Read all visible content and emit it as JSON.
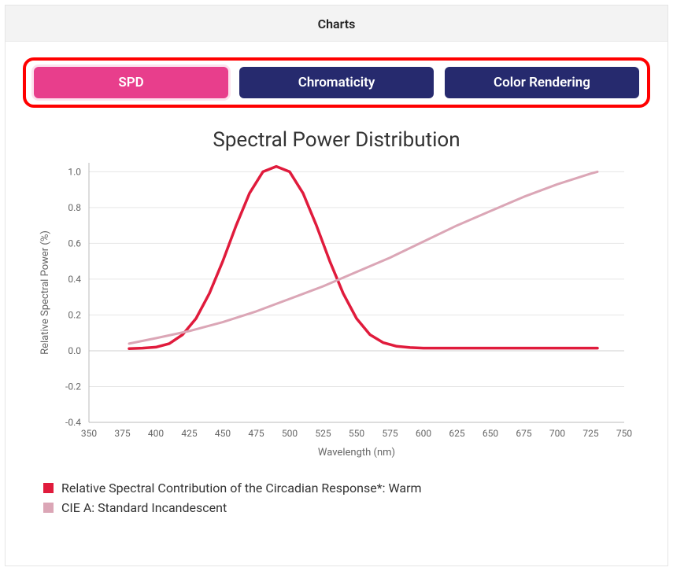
{
  "header": {
    "title": "Charts"
  },
  "tabs": {
    "spd": "SPD",
    "chromaticity": "Chromaticity",
    "color_rendering": "Color Rendering",
    "active": "spd"
  },
  "chart": {
    "title": "Spectral Power Distribution"
  },
  "legend": {
    "series1": "Relative Spectral Contribution of the Circadian Response*: Warm",
    "series2": "CIE A: Standard Incandescent"
  },
  "colors": {
    "series1": "#e01b3c",
    "series2": "#dba6b6",
    "accent_active": "#e83e8c",
    "accent_inactive": "#262a6e",
    "highlight_box": "#ff0000"
  },
  "chart_data": {
    "type": "line",
    "title": "Spectral Power Distribution",
    "xlabel": "Wavelength (nm)",
    "ylabel": "Relative Spectral Power (%)",
    "xlim": [
      350,
      750
    ],
    "ylim": [
      -0.4,
      1.05
    ],
    "xticks": [
      350,
      375,
      400,
      425,
      450,
      475,
      500,
      525,
      550,
      575,
      600,
      625,
      650,
      675,
      700,
      725,
      750
    ],
    "yticks": [
      -0.4,
      -0.2,
      0.0,
      0.2,
      0.4,
      0.6,
      0.8,
      1.0
    ],
    "grid": true,
    "series": [
      {
        "name": "Relative Spectral Contribution of the Circadian Response*: Warm",
        "color": "#e01b3c",
        "x": [
          380,
          390,
          400,
          410,
          420,
          430,
          440,
          450,
          460,
          470,
          480,
          490,
          500,
          510,
          520,
          530,
          540,
          550,
          560,
          570,
          580,
          590,
          600,
          625,
          650,
          675,
          700,
          725,
          730
        ],
        "y": [
          0.012,
          0.015,
          0.02,
          0.04,
          0.09,
          0.18,
          0.32,
          0.5,
          0.7,
          0.88,
          1.0,
          1.03,
          1.0,
          0.88,
          0.7,
          0.5,
          0.32,
          0.18,
          0.09,
          0.045,
          0.025,
          0.018,
          0.015,
          0.015,
          0.015,
          0.015,
          0.015,
          0.015,
          0.015
        ]
      },
      {
        "name": "CIE A: Standard Incandescent",
        "color": "#dba6b6",
        "x": [
          380,
          400,
          425,
          450,
          475,
          500,
          525,
          550,
          575,
          600,
          625,
          650,
          675,
          700,
          725,
          730
        ],
        "y": [
          0.04,
          0.07,
          0.11,
          0.16,
          0.22,
          0.29,
          0.36,
          0.44,
          0.52,
          0.61,
          0.7,
          0.78,
          0.86,
          0.93,
          0.99,
          1.0
        ]
      }
    ]
  }
}
